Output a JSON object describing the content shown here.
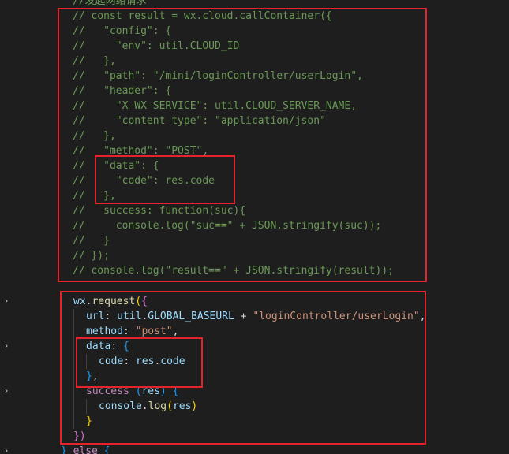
{
  "window": {
    "title": ""
  },
  "comment_block": {
    "lines": [
      "//发起网络请求",
      "// const result = wx.cloud.callContainer({",
      "//   \"config\": {",
      "//     \"env\": util.CLOUD_ID",
      "//   },",
      "//   \"path\": \"/mini/loginController/userLogin\",",
      "//   \"header\": {",
      "//     \"X-WX-SERVICE\": util.CLOUD_SERVER_NAME,",
      "//     \"content-type\": \"application/json\"",
      "//   },",
      "//   \"method\": \"POST\",",
      "//   \"data\": {",
      "//     \"code\": res.code",
      "//   },",
      "//   success: function(suc){",
      "//     console.log(\"suc==\" + JSON.stringify(suc));",
      "//   }",
      "// });",
      "// console.log(\"result==\" + JSON.stringify(result));"
    ]
  },
  "request_block": {
    "l1": {
      "obj": "wx",
      "dot": ".",
      "method": "request",
      "paren": "(",
      "brace": "{"
    },
    "l2": {
      "key": "url",
      "colon": ": ",
      "obj": "util",
      "dot": ".",
      "prop": "GLOBAL_BASEURL",
      "plus": " + ",
      "str": "\"loginController/userLogin\"",
      "comma": ","
    },
    "l3": {
      "key": "method",
      "colon": ": ",
      "str": "\"post\"",
      "comma": ","
    },
    "l4": {
      "key": "data",
      "colon": ": ",
      "brace": "{"
    },
    "l5": {
      "key": "code",
      "colon": ": ",
      "obj": "res",
      "dot": ".",
      "prop": "code"
    },
    "l6": {
      "brace": "}",
      "comma": ","
    },
    "l7": {
      "key": "success",
      "sp": " ",
      "paren_open": "(",
      "param": "res",
      "paren_close": ")",
      "sp2": " ",
      "brace": "{"
    },
    "l8": {
      "obj": "console",
      "dot": ".",
      "method": "log",
      "paren_open": "(",
      "arg": "res",
      "paren_close": ")"
    },
    "l9": {
      "brace": "}"
    },
    "l10": {
      "paren": "})"
    },
    "l11": {
      "brace_close": "}",
      "kw": "else",
      "brace_open": "{"
    }
  },
  "colors": {
    "background": "#1e1e1e",
    "comment": "#6a9955",
    "highlight_box": "#e5232d"
  },
  "icons": {
    "fold": "chevron-right-icon"
  }
}
